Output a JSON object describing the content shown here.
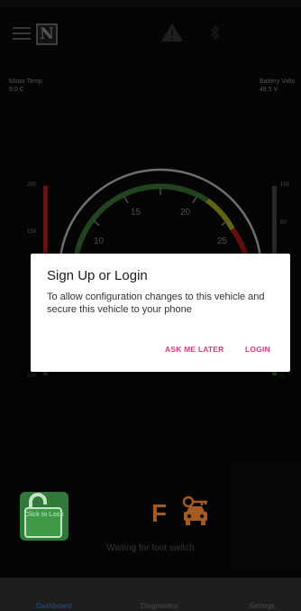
{
  "status_bar": {},
  "top_bar": {
    "menu_icon": "hamburger-icon",
    "logo_letter": "N",
    "warning_icon": "warning-triangle-icon",
    "bluetooth_icon": "bluetooth-icon"
  },
  "readouts": {
    "motor_temp_label": "Motor Temp",
    "motor_temp_value": "9.0 C",
    "battery_volts_label": "Battery Volts",
    "battery_volts_value": "48.5 V"
  },
  "gauge": {
    "ticks": [
      "10",
      "15",
      "20",
      "25"
    ],
    "left_scale": [
      "200",
      "150"
    ],
    "left_bottom": "100",
    "right_scale": [
      "100",
      "80"
    ],
    "right_bottom": "0"
  },
  "dialog": {
    "title": "Sign Up or Login",
    "message": "To allow configuration changes to this vehicle and secure this vehicle to your phone",
    "ask_later_label": "ASK ME LATER",
    "login_label": "LOGIN",
    "accent_color": "#e2357a"
  },
  "controls": {
    "lock_label": "Click to Lock",
    "gear_letter": "F",
    "car_key_icon": "car-key-icon",
    "waiting_text": "Waiting for foot switch"
  },
  "nav": {
    "dashboard": "Dashboard",
    "diagnostics": "Diagnostics",
    "settings": "Settings",
    "active_color": "#2a4f86"
  }
}
